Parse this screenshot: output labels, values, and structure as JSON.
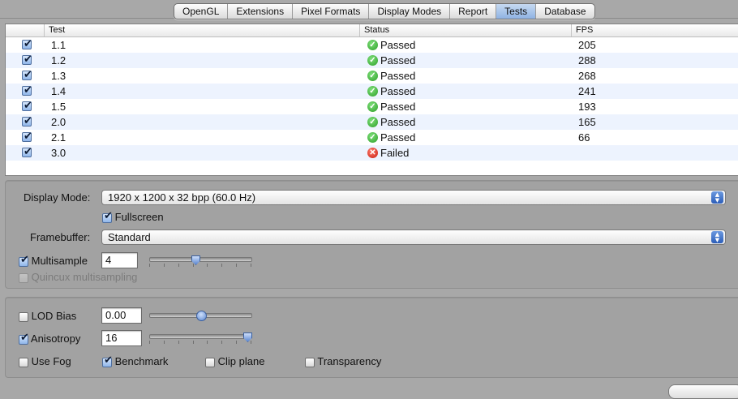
{
  "tabs": [
    {
      "label": "OpenGL",
      "active": false
    },
    {
      "label": "Extensions",
      "active": false
    },
    {
      "label": "Pixel Formats",
      "active": false
    },
    {
      "label": "Display Modes",
      "active": false
    },
    {
      "label": "Report",
      "active": false
    },
    {
      "label": "Tests",
      "active": true
    },
    {
      "label": "Database",
      "active": false
    }
  ],
  "table": {
    "headers": [
      "",
      "Test",
      "Status",
      "FPS"
    ],
    "rows": [
      {
        "checked": true,
        "test": "1.1",
        "status": "Passed",
        "status_type": "passed",
        "fps": "205"
      },
      {
        "checked": true,
        "test": "1.2",
        "status": "Passed",
        "status_type": "passed",
        "fps": "288"
      },
      {
        "checked": true,
        "test": "1.3",
        "status": "Passed",
        "status_type": "passed",
        "fps": "268"
      },
      {
        "checked": true,
        "test": "1.4",
        "status": "Passed",
        "status_type": "passed",
        "fps": "241"
      },
      {
        "checked": true,
        "test": "1.5",
        "status": "Passed",
        "status_type": "passed",
        "fps": "193"
      },
      {
        "checked": true,
        "test": "2.0",
        "status": "Passed",
        "status_type": "passed",
        "fps": "165"
      },
      {
        "checked": true,
        "test": "2.1",
        "status": "Passed",
        "status_type": "passed",
        "fps": "66"
      },
      {
        "checked": true,
        "test": "3.0",
        "status": "Failed",
        "status_type": "failed",
        "fps": ""
      }
    ]
  },
  "settings": {
    "display_mode_label": "Display Mode:",
    "display_mode_value": "1920 x 1200 x 32 bpp (60.0 Hz)",
    "fullscreen_label": "Fullscreen",
    "fullscreen_checked": true,
    "framebuffer_label": "Framebuffer:",
    "framebuffer_value": "Standard",
    "multisample_label": "Multisample",
    "multisample_checked": true,
    "multisample_value": "4",
    "multisample_slider_fraction": 0.45,
    "quincux_label": "Quincux multisampling",
    "quincux_enabled": false,
    "lod_bias_label": "LOD Bias",
    "lod_bias_checked": false,
    "lod_bias_value": "0.00",
    "lod_bias_slider_fraction": 0.5,
    "anisotropy_label": "Anisotropy",
    "anisotropy_checked": true,
    "anisotropy_value": "16",
    "anisotropy_slider_fraction": 1.0,
    "use_fog_label": "Use Fog",
    "use_fog_checked": false,
    "benchmark_label": "Benchmark",
    "benchmark_checked": true,
    "clip_plane_label": "Clip plane",
    "clip_plane_checked": false,
    "transparency_label": "Transparency",
    "transparency_checked": false
  },
  "colors": {
    "window_bg": "#a8a8a8",
    "row_alt": "#edf3fe",
    "passed": "#2e9f2a",
    "failed": "#c81e12",
    "active_tab": "#8fb3e3"
  },
  "icons": {
    "passed": "checkmark-circle-icon",
    "failed": "x-circle-icon",
    "popup": "up-down-arrows-icon"
  }
}
